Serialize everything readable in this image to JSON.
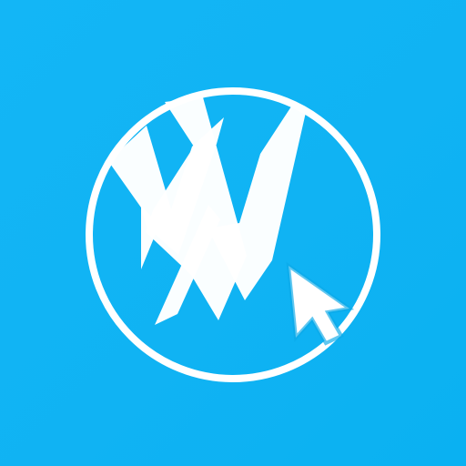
{
  "icon": {
    "name": "W app icon",
    "background_color": "#14b5f5",
    "foreground_color": "#ffffff",
    "cursor_icon": "mouse-pointer-icon",
    "logo_icon": "w-logo-icon"
  }
}
